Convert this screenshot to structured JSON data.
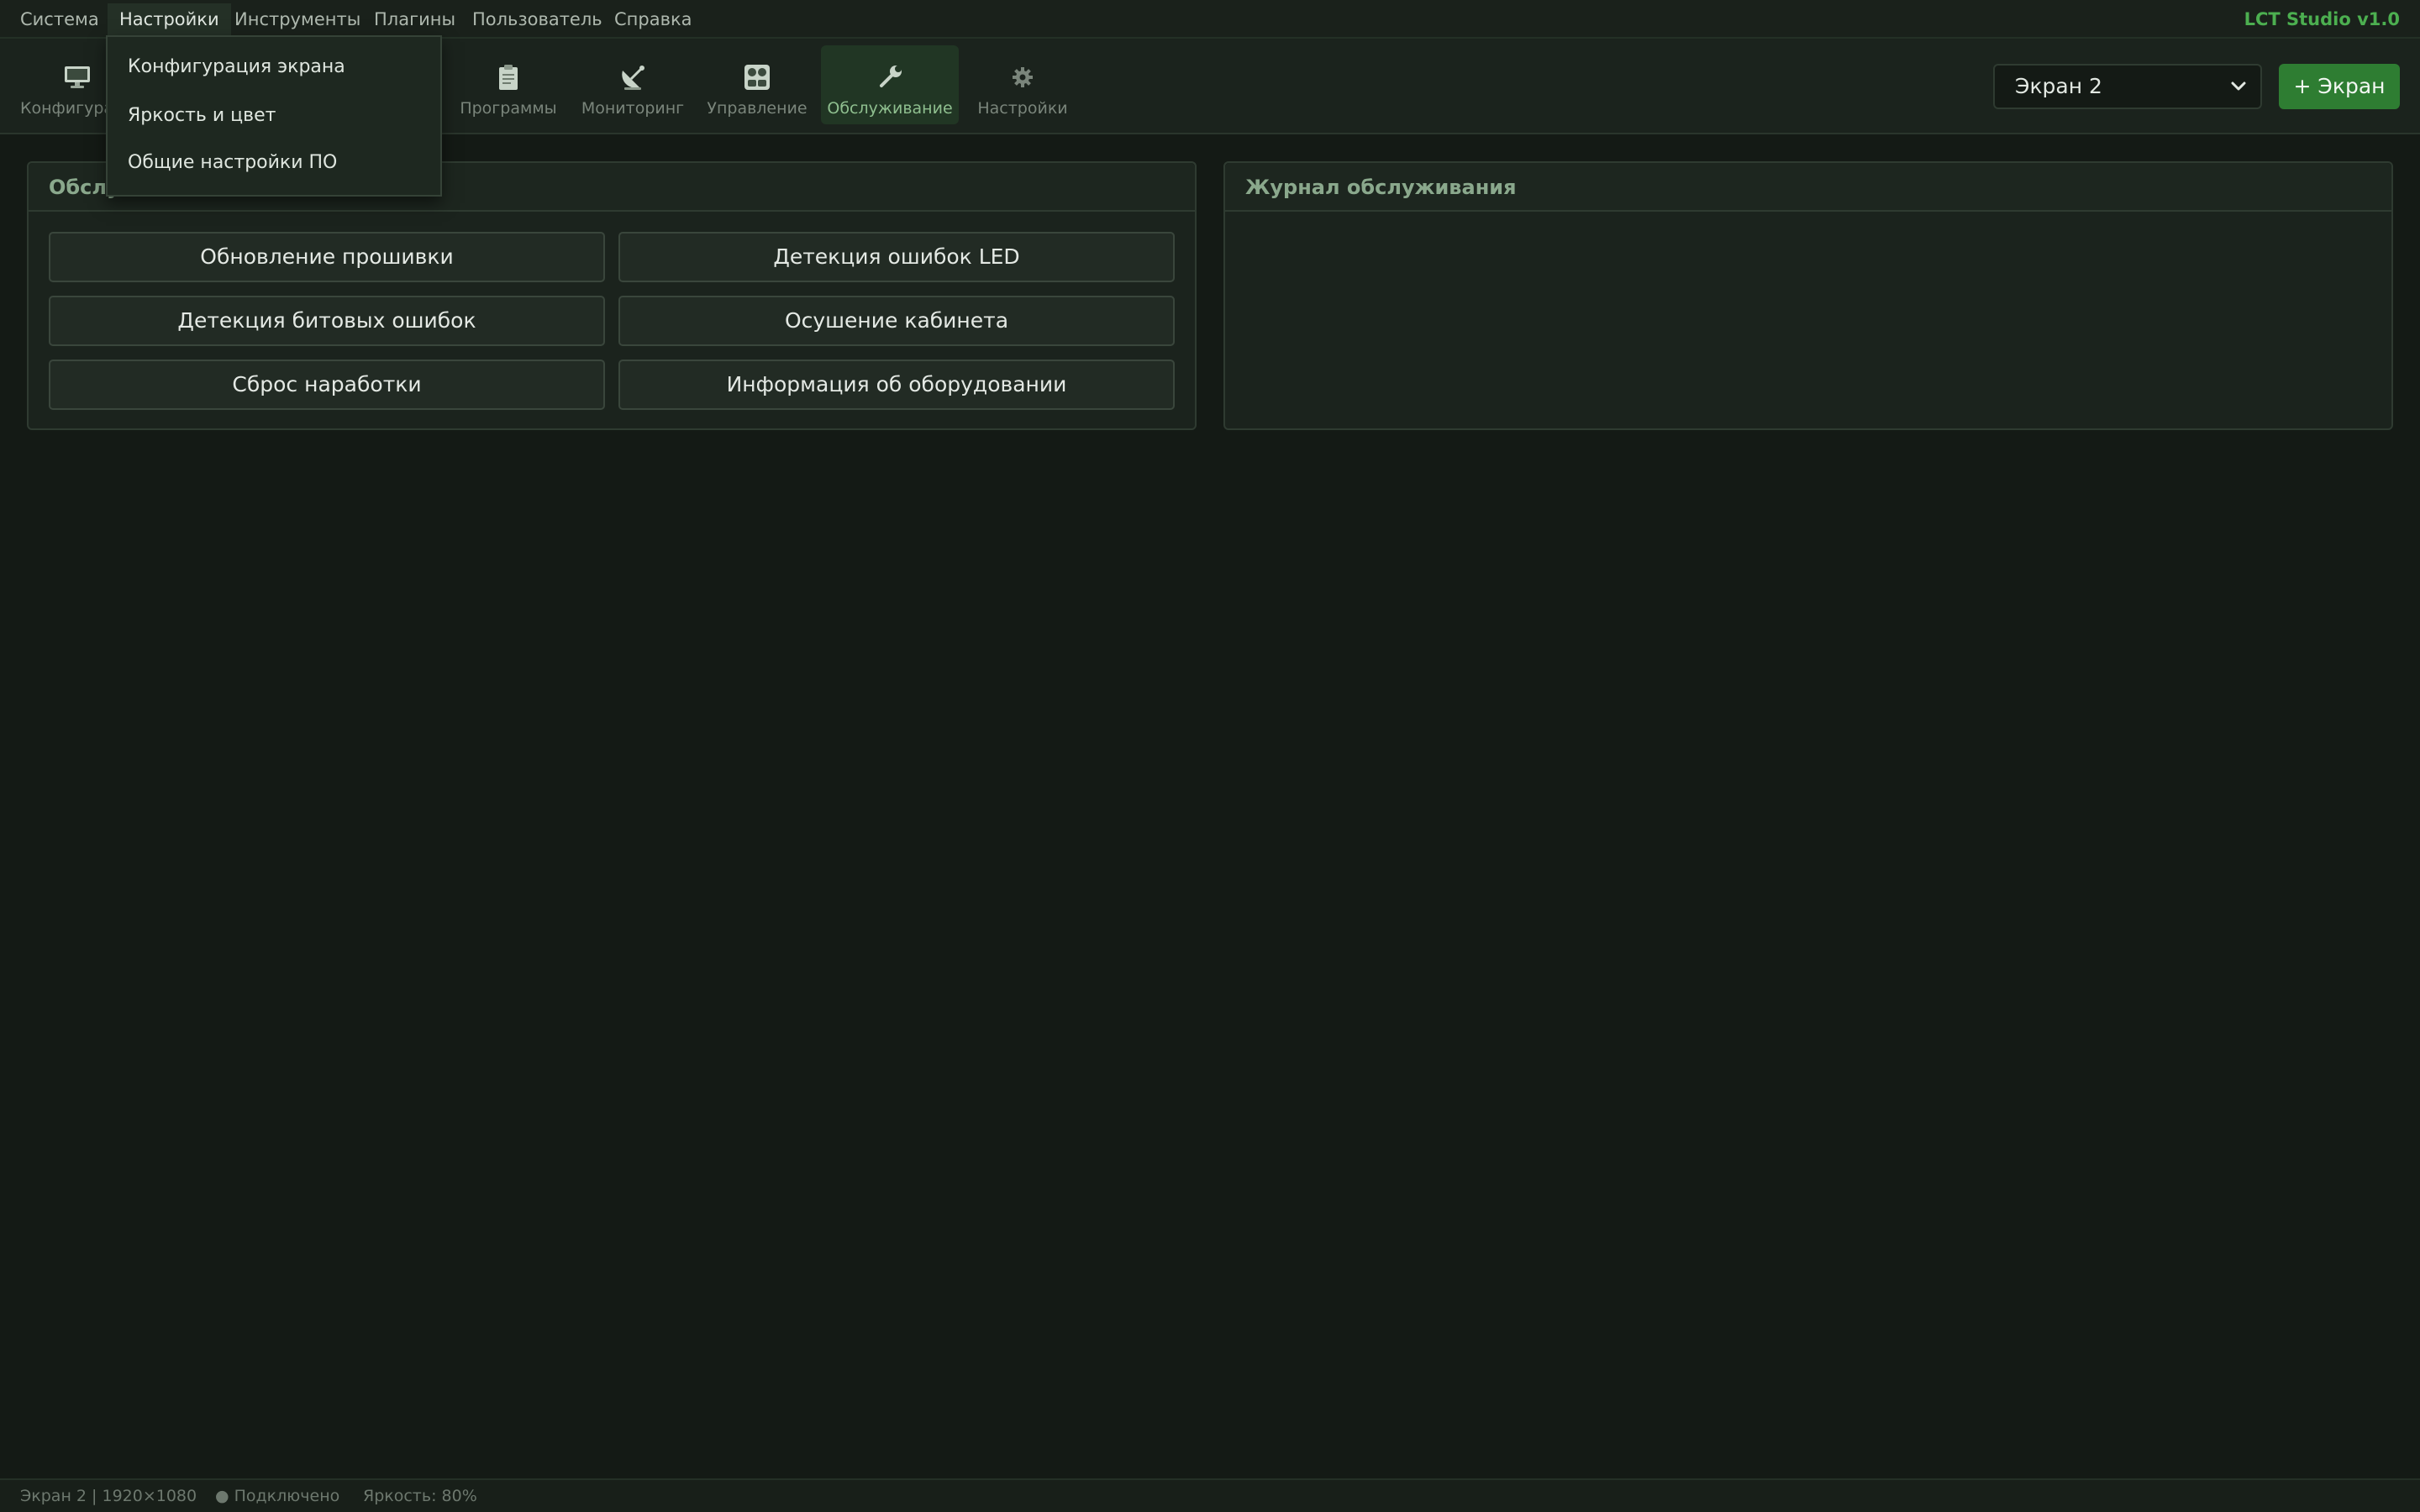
{
  "menubar": {
    "items": [
      {
        "label": "Система"
      },
      {
        "label": "Настройки"
      },
      {
        "label": "Инструменты"
      },
      {
        "label": "Плагины"
      },
      {
        "label": "Пользователь"
      },
      {
        "label": "Справка"
      }
    ],
    "active": "Настройки",
    "brand": "LCT Studio v1.0",
    "brand_color": "#4caf50"
  },
  "dropdown": {
    "items": [
      {
        "label": "Конфигурация экрана"
      },
      {
        "label": "Яркость и цвет"
      },
      {
        "label": "Общие настройки ПО"
      }
    ]
  },
  "toolbar": {
    "tools": [
      {
        "label": "Конфигурац",
        "icon": "monitor-icon"
      },
      {
        "label": "Программы",
        "icon": "clipboard-icon"
      },
      {
        "label": "Мониторинг",
        "icon": "satellite-dish-icon"
      },
      {
        "label": "Управление",
        "icon": "control-panel-icon"
      },
      {
        "label": "Обслуживание",
        "icon": "wrench-icon"
      },
      {
        "label": "Настройки",
        "icon": "gear-icon"
      }
    ],
    "active_tool": "Обслуживание",
    "screen_select": {
      "value": "Экран 2"
    },
    "add_screen_label": "+ Экран",
    "accent_color": "#2e7d32"
  },
  "maintenance_panel": {
    "title": "Обслу",
    "buttons": [
      {
        "label": "Обновление прошивки"
      },
      {
        "label": "Детекция ошибок LED"
      },
      {
        "label": "Детекция битовых ошибок"
      },
      {
        "label": "Осушение кабинета"
      },
      {
        "label": "Сброс наработки"
      },
      {
        "label": "Информация об оборудовании"
      }
    ]
  },
  "log_panel": {
    "title": "Журнал обслуживания"
  },
  "statusbar": {
    "screen_info": "Экран 2 | 1920×1080",
    "connection": "● Подключено",
    "brightness": "Яркость: 80%"
  }
}
